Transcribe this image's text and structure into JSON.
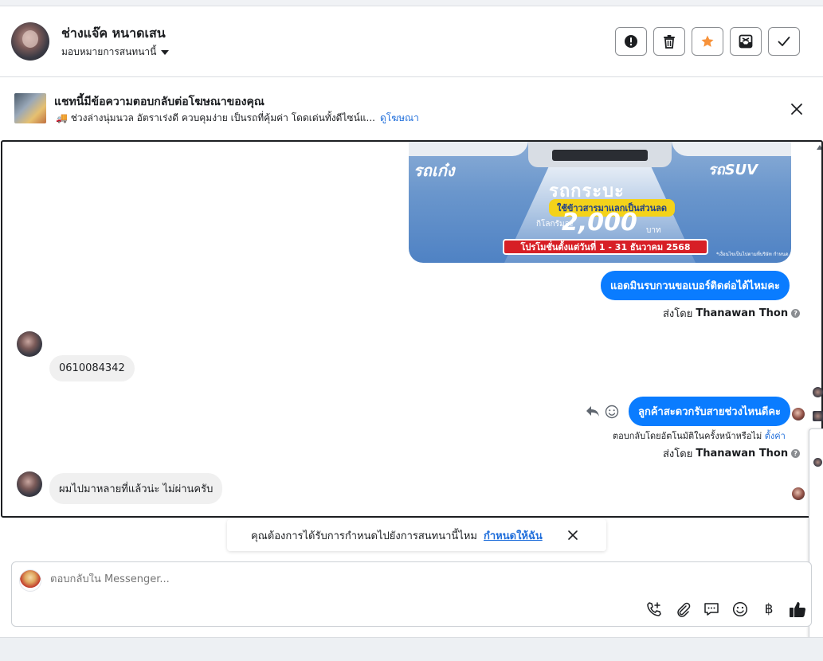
{
  "header": {
    "contact_name": "ช่างแจ๊ค หนาดเสน",
    "assign_label": "มอบหมายการสนทนานี้"
  },
  "ad": {
    "title": "แชทนี้มีข้อความตอบกลับต่อโฆษณาของคุณ",
    "subtitle": "🚚 ช่วงล่างนุ่มนวล อัตราเร่งดี ควบคุมง่าย เป็นรถที่คุ้มค่า โดดเด่นทั้งดีไซน์แ...",
    "link": "ดูโฆษณา"
  },
  "promo": {
    "left_label": "รถเก๋ง",
    "right_label": "รถSUV",
    "main": "รถกระบะ",
    "pill": "ใช้ข้าวสารมาแลกเป็นส่วนลด",
    "price_prefix": "กิโลกรัมละ",
    "price": "2,000",
    "price_unit": "บาท",
    "banner": "โปรโมชั่นตั้งแต่วันที่ 1 - 31 ธันวาคม 2568",
    "fine_print": "*เงื่อนไขเป็นไปตามที่บริษัท กำหนด"
  },
  "messages": {
    "out1": "แอดมินรบกวนขอเบอร์ติดต่อได้ไหมคะ",
    "sent_prefix": "ส่งโดย",
    "sent_name": "Thanawan Thon",
    "in1": "0610084342",
    "out2": "ลูกค้าสะดวกรับสายช่วงไหนดีคะ",
    "auto_reply": "ตอบกลับโดยอัตโนมัติในครั้งหน้าหรือไม่",
    "auto_reply_link": "ตั้งค่า",
    "in2": "ผมไปมาหลายที่แล้วน่ะ ไม่ผ่านครับ"
  },
  "notice": {
    "text": "คุณต้องการได้รับการกำหนดไปยังการสนทนานี้ไหม",
    "link": "กำหนดให้ฉัน"
  },
  "composer": {
    "placeholder": "ตอบกลับใน Messenger..."
  },
  "icons": {
    "report": "exclamation-circle-icon",
    "delete": "trash-icon",
    "star": "star-icon",
    "archive": "archive-icon",
    "done": "check-icon",
    "star_color": "#f7923a",
    "accent": "#0a7cff",
    "link_color": "#216fdb"
  }
}
